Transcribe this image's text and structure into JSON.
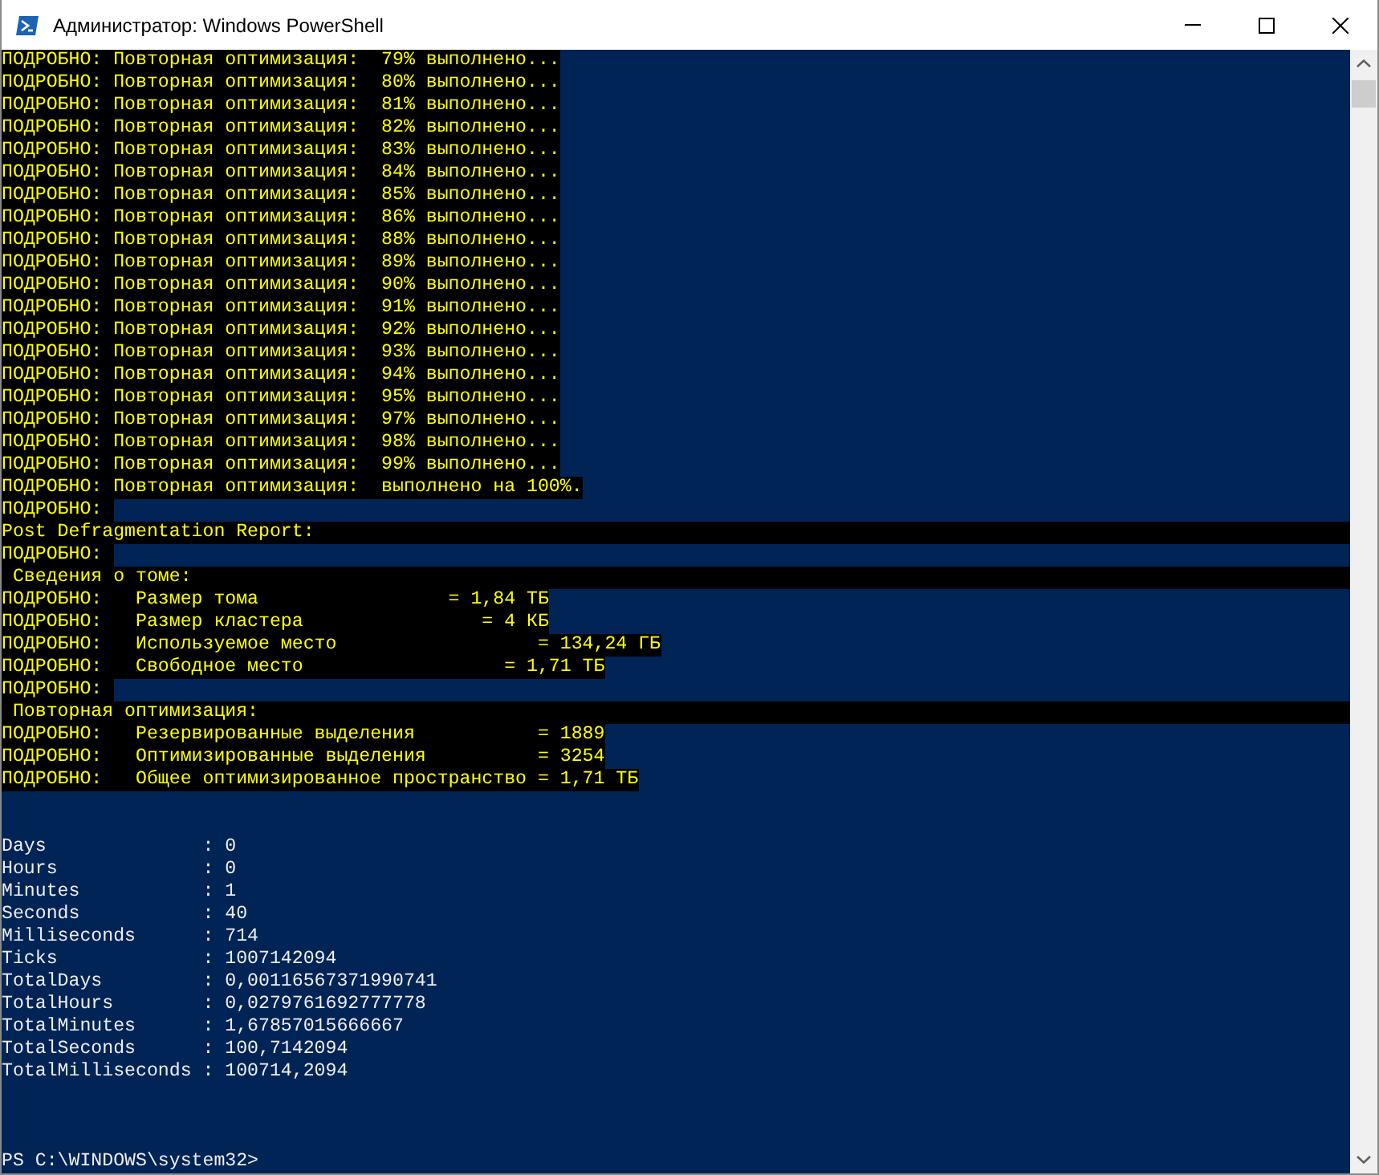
{
  "window": {
    "title": "Администратор: Windows PowerShell"
  },
  "console": {
    "lines": [
      {
        "kind": "verbose",
        "text": "ПОДРОБНО: Повторная оптимизация:  79% выполнено..."
      },
      {
        "kind": "verbose",
        "text": "ПОДРОБНО: Повторная оптимизация:  80% выполнено..."
      },
      {
        "kind": "verbose",
        "text": "ПОДРОБНО: Повторная оптимизация:  81% выполнено..."
      },
      {
        "kind": "verbose",
        "text": "ПОДРОБНО: Повторная оптимизация:  82% выполнено..."
      },
      {
        "kind": "verbose",
        "text": "ПОДРОБНО: Повторная оптимизация:  83% выполнено..."
      },
      {
        "kind": "verbose",
        "text": "ПОДРОБНО: Повторная оптимизация:  84% выполнено..."
      },
      {
        "kind": "verbose",
        "text": "ПОДРОБНО: Повторная оптимизация:  85% выполнено..."
      },
      {
        "kind": "verbose",
        "text": "ПОДРОБНО: Повторная оптимизация:  86% выполнено..."
      },
      {
        "kind": "verbose",
        "text": "ПОДРОБНО: Повторная оптимизация:  88% выполнено..."
      },
      {
        "kind": "verbose",
        "text": "ПОДРОБНО: Повторная оптимизация:  89% выполнено..."
      },
      {
        "kind": "verbose",
        "text": "ПОДРОБНО: Повторная оптимизация:  90% выполнено..."
      },
      {
        "kind": "verbose",
        "text": "ПОДРОБНО: Повторная оптимизация:  91% выполнено..."
      },
      {
        "kind": "verbose",
        "text": "ПОДРОБНО: Повторная оптимизация:  92% выполнено..."
      },
      {
        "kind": "verbose",
        "text": "ПОДРОБНО: Повторная оптимизация:  93% выполнено..."
      },
      {
        "kind": "verbose",
        "text": "ПОДРОБНО: Повторная оптимизация:  94% выполнено..."
      },
      {
        "kind": "verbose",
        "text": "ПОДРОБНО: Повторная оптимизация:  95% выполнено..."
      },
      {
        "kind": "verbose",
        "text": "ПОДРОБНО: Повторная оптимизация:  97% выполнено..."
      },
      {
        "kind": "verbose",
        "text": "ПОДРОБНО: Повторная оптимизация:  98% выполнено..."
      },
      {
        "kind": "verbose",
        "text": "ПОДРОБНО: Повторная оптимизация:  99% выполнено..."
      },
      {
        "kind": "verbose",
        "text": "ПОДРОБНО: Повторная оптимизация:  выполнено на 100%."
      },
      {
        "kind": "verbose",
        "text": "ПОДРОБНО: "
      },
      {
        "kind": "banner",
        "text": "Post Defragmentation Report:"
      },
      {
        "kind": "verbose",
        "text": "ПОДРОБНО: "
      },
      {
        "kind": "banner",
        "text": " Сведения о томе:"
      },
      {
        "kind": "verbose",
        "text": "ПОДРОБНО:   Размер тома                 = 1,84 ТБ"
      },
      {
        "kind": "verbose",
        "text": "ПОДРОБНО:   Размер кластера                = 4 КБ"
      },
      {
        "kind": "verbose",
        "text": "ПОДРОБНО:   Используемое место                  = 134,24 ГБ"
      },
      {
        "kind": "verbose",
        "text": "ПОДРОБНО:   Свободное место                  = 1,71 ТБ"
      },
      {
        "kind": "verbose",
        "text": "ПОДРОБНО: "
      },
      {
        "kind": "banner",
        "text": " Повторная оптимизация:"
      },
      {
        "kind": "verbose",
        "text": "ПОДРОБНО:   Резервированные выделения           = 1889"
      },
      {
        "kind": "verbose",
        "text": "ПОДРОБНО:   Оптимизированные выделения          = 3254"
      },
      {
        "kind": "verbose",
        "text": "ПОДРОБНО:   Общее оптимизированное пространство = 1,71 ТБ"
      },
      {
        "kind": "blank"
      },
      {
        "kind": "blank"
      },
      {
        "kind": "output",
        "text": "Days              : 0"
      },
      {
        "kind": "output",
        "text": "Hours             : 0"
      },
      {
        "kind": "output",
        "text": "Minutes           : 1"
      },
      {
        "kind": "output",
        "text": "Seconds           : 40"
      },
      {
        "kind": "output",
        "text": "Milliseconds      : 714"
      },
      {
        "kind": "output",
        "text": "Ticks             : 1007142094"
      },
      {
        "kind": "output",
        "text": "TotalDays         : 0,00116567371990741"
      },
      {
        "kind": "output",
        "text": "TotalHours        : 0,0279761692777778"
      },
      {
        "kind": "output",
        "text": "TotalMinutes      : 1,67857015666667"
      },
      {
        "kind": "output",
        "text": "TotalSeconds      : 100,7142094"
      },
      {
        "kind": "output",
        "text": "TotalMilliseconds : 100714,2094"
      },
      {
        "kind": "blank"
      },
      {
        "kind": "blank"
      },
      {
        "kind": "blank"
      },
      {
        "kind": "prompt",
        "text": "PS C:\\WINDOWS\\system32>"
      }
    ]
  }
}
